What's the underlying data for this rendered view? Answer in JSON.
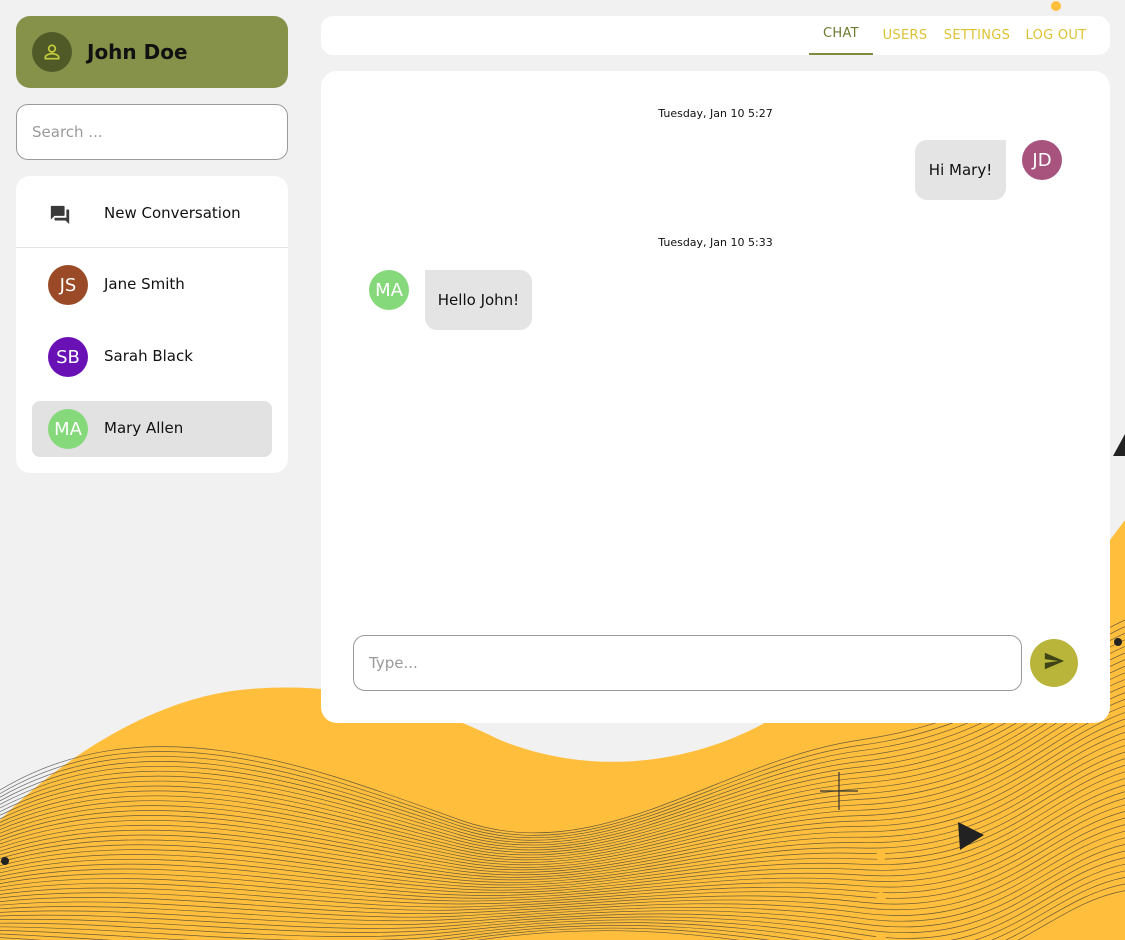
{
  "user": {
    "name": "John Doe",
    "icon": "person-icon"
  },
  "search": {
    "placeholder": "Search ..."
  },
  "sidebar": {
    "new_conversation": {
      "label": "New Conversation",
      "icon": "forum-icon"
    },
    "contacts": [
      {
        "initials": "JS",
        "name": "Jane Smith",
        "color": "#9a4a26",
        "active": false
      },
      {
        "initials": "SB",
        "name": "Sarah Black",
        "color": "#6a11b6",
        "active": false
      },
      {
        "initials": "MA",
        "name": "Mary Allen",
        "color": "#86d97b",
        "active": true
      }
    ]
  },
  "nav": {
    "items": [
      {
        "label": "CHAT",
        "active": true
      },
      {
        "label": "USERS",
        "active": false
      },
      {
        "label": "SETTINGS",
        "active": false
      },
      {
        "label": "LOG OUT",
        "active": false
      }
    ]
  },
  "chat": {
    "messages": [
      {
        "timestamp": "Tuesday, Jan 10 5:27",
        "text": "Hi Mary!",
        "sender_initials": "JD",
        "sender_color": "#a8527e",
        "mine": true
      },
      {
        "timestamp": "Tuesday, Jan 10 5:33",
        "text": "Hello John!",
        "sender_initials": "MA",
        "sender_color": "#86d97b",
        "mine": false
      }
    ],
    "input_placeholder": "Type...",
    "send_icon": "send-icon"
  },
  "theme": {
    "accent": "#86924a",
    "nav_color": "#dcc232",
    "send_color": "#b9b53b"
  }
}
